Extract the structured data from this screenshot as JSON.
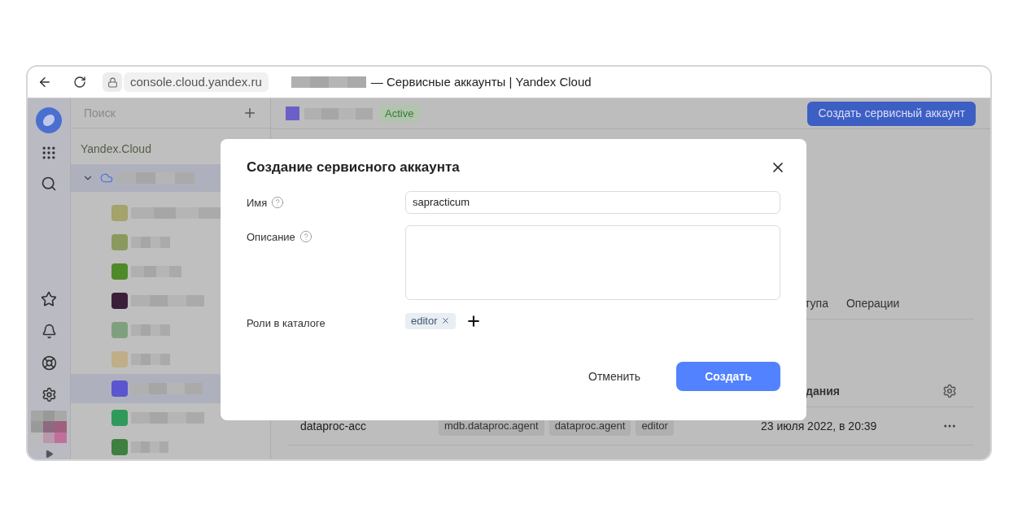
{
  "browser": {
    "url": "console.cloud.yandex.ru",
    "title": "— Сервисные аккаунты | Yandex Cloud"
  },
  "sidebar": {
    "search": {
      "placeholder": "Поиск"
    },
    "root": "Yandex.Cloud",
    "cloud": {
      "expanded": true,
      "selected": true,
      "folders": [
        {
          "color": "#a3a36a",
          "selected": false
        },
        {
          "color": "#8a9a5e",
          "selected": false
        },
        {
          "color": "#4f8a2a",
          "selected": false
        },
        {
          "color": "#3a1f3a",
          "selected": false
        },
        {
          "color": "#7fa07f",
          "selected": false
        },
        {
          "color": "#c0ae88",
          "selected": false
        },
        {
          "color": "#5b55d0",
          "selected": true
        },
        {
          "color": "#2f9a5a",
          "selected": false
        },
        {
          "color": "#3f7f3f",
          "selected": false
        }
      ]
    }
  },
  "header": {
    "status": "Active",
    "create_button": "Создать сервисный аккаунт"
  },
  "tabs": [
    {
      "label": "тупа",
      "selected": false
    },
    {
      "label": "Операции",
      "selected": false
    }
  ],
  "table": {
    "columns": [
      {
        "label": "дания"
      }
    ],
    "rows": [
      {
        "name": "dataproc-acc",
        "roles": [
          "mdb.dataproc.agent",
          "dataproc.agent",
          "editor"
        ],
        "created": "23 июля 2022, в 20:39"
      }
    ]
  },
  "dialog": {
    "title": "Создание сервисного аккаунта",
    "fields": [
      {
        "kind": "input",
        "label": "Имя",
        "help": true,
        "value": "sapracticum"
      },
      {
        "kind": "textarea",
        "label": "Описание",
        "help": true
      },
      {
        "kind": "roles",
        "label": "Роли в каталоге",
        "help": false,
        "roles": [
          "editor"
        ]
      }
    ],
    "buttons": [
      {
        "kind": "secondary",
        "label": "Отменить"
      },
      {
        "kind": "primary",
        "label": "Создать"
      }
    ]
  }
}
